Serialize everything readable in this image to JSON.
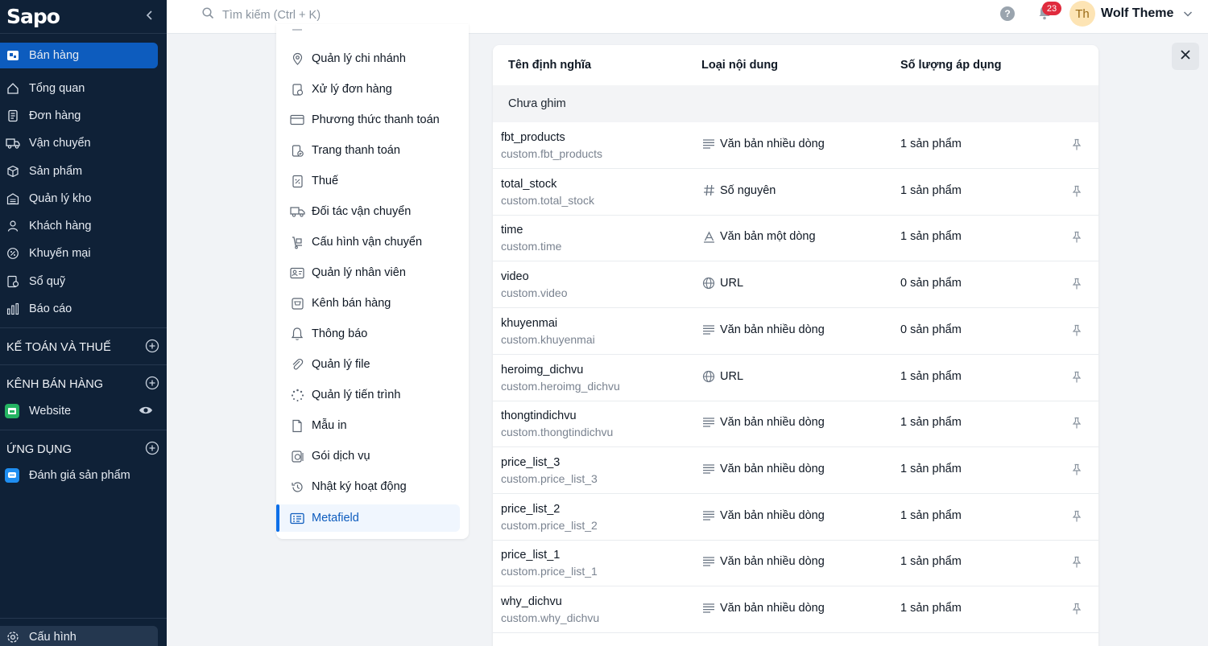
{
  "sidebar": {
    "logo": "Sapo",
    "items": [
      {
        "label": "Bán hàng",
        "icon": "store-icon"
      },
      {
        "label": "Tổng quan",
        "icon": "home-icon"
      },
      {
        "label": "Đơn hàng",
        "icon": "orders-icon"
      },
      {
        "label": "Vận chuyển",
        "icon": "truck-icon"
      },
      {
        "label": "Sản phẩm",
        "icon": "box-icon"
      },
      {
        "label": "Quản lý kho",
        "icon": "warehouse-icon"
      },
      {
        "label": "Khách hàng",
        "icon": "user-icon"
      },
      {
        "label": "Khuyến mại",
        "icon": "discount-icon"
      },
      {
        "label": "Sổ quỹ",
        "icon": "cashbook-icon"
      },
      {
        "label": "Báo cáo",
        "icon": "chart-icon"
      }
    ],
    "sections": {
      "accounting": "KẾ TOÁN VÀ THUẾ",
      "channels": "KÊNH BÁN HÀNG",
      "apps": "ỨNG DỤNG"
    },
    "website": "Website",
    "app_review": "Đánh giá sản phẩm",
    "config": "Cấu hình"
  },
  "header": {
    "search_placeholder": "Tìm kiếm (Ctrl + K)",
    "notification_count": "23",
    "avatar_initials": "Th",
    "user_name": "Wolf Theme"
  },
  "settings_menu": [
    {
      "label": "Quản lý chi nhánh",
      "icon": "branch-icon"
    },
    {
      "label": "Xử lý đơn hàng",
      "icon": "order-process-icon"
    },
    {
      "label": "Phương thức thanh toán",
      "icon": "card-icon"
    },
    {
      "label": "Trang thanh toán",
      "icon": "checkout-icon"
    },
    {
      "label": "Thuế",
      "icon": "tax-icon"
    },
    {
      "label": "Đối tác vận chuyển",
      "icon": "shipping-partner-icon"
    },
    {
      "label": "Cấu hình vận chuyển",
      "icon": "shipping-config-icon"
    },
    {
      "label": "Quản lý nhân viên",
      "icon": "staff-icon"
    },
    {
      "label": "Kênh bán hàng",
      "icon": "sales-channel-icon"
    },
    {
      "label": "Thông báo",
      "icon": "bell-icon"
    },
    {
      "label": "Quản lý file",
      "icon": "paperclip-icon"
    },
    {
      "label": "Quản lý tiến trình",
      "icon": "spinner-icon"
    },
    {
      "label": "Mẫu in",
      "icon": "print-template-icon"
    },
    {
      "label": "Gói dịch vụ",
      "icon": "service-package-icon"
    },
    {
      "label": "Nhật ký hoạt động",
      "icon": "history-icon"
    },
    {
      "label": "Metafield",
      "icon": "metafield-icon"
    }
  ],
  "table": {
    "headers": [
      "Tên định nghĩa",
      "Loại nội dung",
      "Số lượng áp dụng"
    ],
    "group_label": "Chưa ghim",
    "rows": [
      {
        "name": "fbt_products",
        "key": "custom.fbt_products",
        "type": "Văn bản nhiều dòng",
        "type_icon": "multiline-text-icon",
        "count": "1 sản phẩm"
      },
      {
        "name": "total_stock",
        "key": "custom.total_stock",
        "type": "Số nguyên",
        "type_icon": "hash-icon",
        "count": "1 sản phẩm"
      },
      {
        "name": "time",
        "key": "custom.time",
        "type": "Văn bản một dòng",
        "type_icon": "single-line-text-icon",
        "count": "1 sản phẩm"
      },
      {
        "name": "video",
        "key": "custom.video",
        "type": "URL",
        "type_icon": "globe-icon",
        "count": "0 sản phẩm"
      },
      {
        "name": "khuyenmai",
        "key": "custom.khuyenmai",
        "type": "Văn bản nhiều dòng",
        "type_icon": "multiline-text-icon",
        "count": "0 sản phẩm"
      },
      {
        "name": "heroimg_dichvu",
        "key": "custom.heroimg_dichvu",
        "type": "URL",
        "type_icon": "globe-icon",
        "count": "1 sản phẩm"
      },
      {
        "name": "thongtindichvu",
        "key": "custom.thongtindichvu",
        "type": "Văn bản nhiều dòng",
        "type_icon": "multiline-text-icon",
        "count": "1 sản phẩm"
      },
      {
        "name": "price_list_3",
        "key": "custom.price_list_3",
        "type": "Văn bản nhiều dòng",
        "type_icon": "multiline-text-icon",
        "count": "1 sản phẩm"
      },
      {
        "name": "price_list_2",
        "key": "custom.price_list_2",
        "type": "Văn bản nhiều dòng",
        "type_icon": "multiline-text-icon",
        "count": "1 sản phẩm"
      },
      {
        "name": "price_list_1",
        "key": "custom.price_list_1",
        "type": "Văn bản nhiều dòng",
        "type_icon": "multiline-text-icon",
        "count": "1 sản phẩm"
      },
      {
        "name": "why_dichvu",
        "key": "custom.why_dichvu",
        "type": "Văn bản nhiều dòng",
        "type_icon": "multiline-text-icon",
        "count": "1 sản phẩm"
      }
    ]
  },
  "colors": {
    "sidebar_bg": "#0f2137",
    "accent": "#0d5cbe",
    "badge": "#e02b3d"
  }
}
